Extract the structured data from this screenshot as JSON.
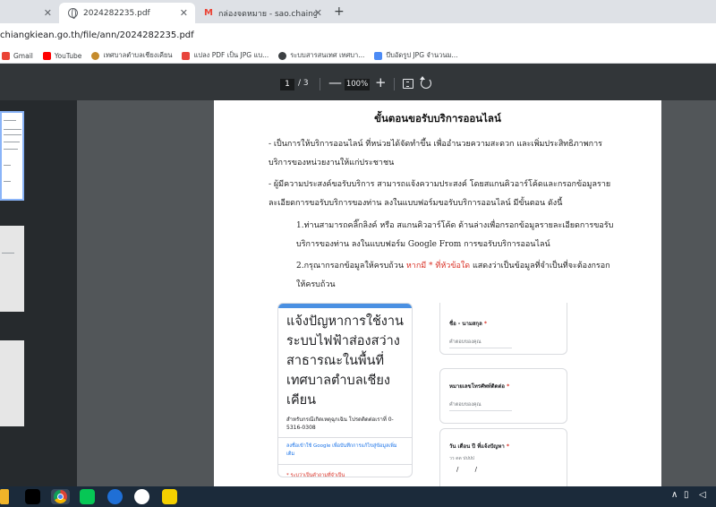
{
  "browser": {
    "tabs": [
      {
        "title": "",
        "active": false
      },
      {
        "title": "2024282235.pdf",
        "active": true
      },
      {
        "title": "กล่องจดหมาย - sao.chaingkiean@",
        "active": false
      }
    ],
    "tab_close": "✕",
    "new_tab": "+",
    "url": "chiangkiean.go.th/file/ann/2024282235.pdf"
  },
  "bookmarks": [
    {
      "label": "Gmail",
      "color": "#ea4335"
    },
    {
      "label": "YouTube",
      "color": "#ff0000"
    },
    {
      "label": "เทศบาลตำบลเชียงเคียน",
      "color": "#c58b2c"
    },
    {
      "label": "แปลง PDF เป็น JPG แบ...",
      "color": "#e8453c"
    },
    {
      "label": "ระบบสารสนเทศ เทศบา...",
      "color": "#3c4043"
    },
    {
      "label": "บีบอัดรูป JPG จำนวนม...",
      "color": "#4c8bf5"
    }
  ],
  "pdf_toolbar": {
    "current_page": "1",
    "page_separator": "/",
    "total_pages": "3",
    "zoom_minus": "—",
    "zoom": "100%",
    "zoom_plus": "+"
  },
  "document": {
    "title": "ขั้นตอนขอรับบริการออนไลน์",
    "p1": "- เป็นการให้บริการออนไลน์ ที่หน่วยได้จัดทำขึ้น เพื่ออำนวยความสะดวก และเพิ่มประสิทธิภาพการบริการของหน่วยงานให้แก่ประชาชน",
    "p2": "- ผู้มีความประสงค์ขอรับบริการ สามารถแจ้งความประสงค์ โดยสแกนคิวอาร์โค้ดและกรอกข้อมูลรายละเอียดการขอรับบริการของท่าน ลงในแบบฟอร์มขอรับบริการออนไลน์ มีขั้นตอน ดังนี้",
    "p3": "1.ท่านสามารถคลิ๊กลิงค์ หรือ สแกนคิวอาร์โค้ด ด้านล่างเพื่อกรอกข้อมูลรายละเอียดการขอรับบริการของท่าน ลงในแบบฟอร์ม Google From การขอรับบริการออนไลน์",
    "p4_before": "2.กรุณากรอกข้อมูลให้ครบถ้วน ",
    "p4_red": "หากมี * ที่หัวข้อใด",
    "p4_after": " แสดงว่าเป็นข้อมูลที่จำเป็นที่จะต้องกรอกให้ครบถ้วน"
  },
  "form": {
    "title": "แจ้งปัญหาการใช้งาน ระบบไฟฟ้าส่องสว่างสาธารณะในพื้นที่ เทศบาลตำบลเชียงเคียน",
    "subtitle": "สำหรับกรณีเกิดเหตุฉุกเฉิน โปรดติดต่อเราที่ 0-5316-0308",
    "signin_link": "ลงชื่อเข้าใช้ Google เพื่อบันทึกการแก้ไขสู่ข้อมูลเพิ่มเติม",
    "required_note": "* ระบุว่าเป็นคำถามที่จำเป็น",
    "questions": [
      {
        "label": "ชื่อ - นามสกุล",
        "star": "*",
        "placeholder": "คำตอบของคุณ"
      },
      {
        "label": "หมายเลขโทรศัพท์ติดต่อ",
        "star": "*",
        "placeholder": "คำตอบของคุณ"
      },
      {
        "label": "วัน เดือน ปี ที่แจ้งปัญหา",
        "star": "*",
        "date_hint": "วว    ดด    ปปปป",
        "date_value": "/ /"
      }
    ]
  }
}
